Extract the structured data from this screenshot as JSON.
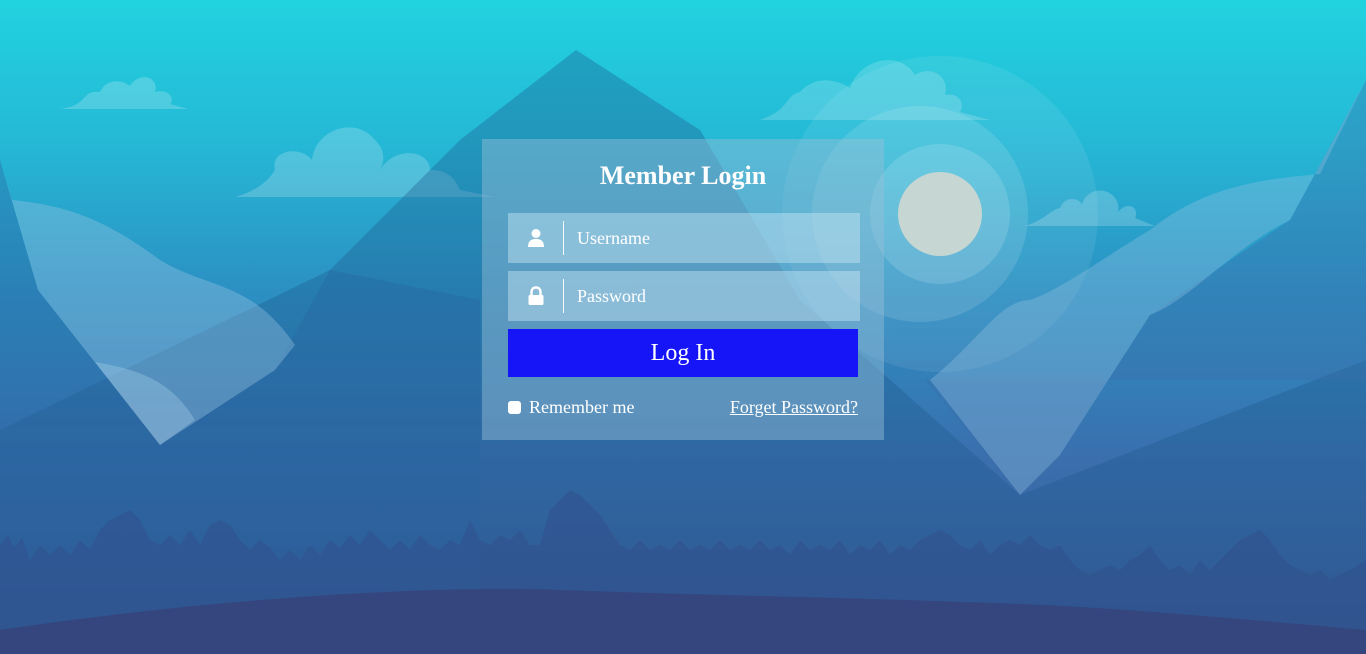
{
  "login": {
    "title": "Member Login",
    "username_placeholder": "Username",
    "password_placeholder": "Password",
    "login_label": "Log In",
    "remember_label": "Remember me",
    "forgot_label": "Forget Password?"
  },
  "colors": {
    "button": "#1515f7",
    "sky_top": "#21d3df",
    "sky_bottom": "#3c5590",
    "moon": "#c6d6d3"
  },
  "icons": {
    "username": "user-icon",
    "password": "lock-icon"
  }
}
